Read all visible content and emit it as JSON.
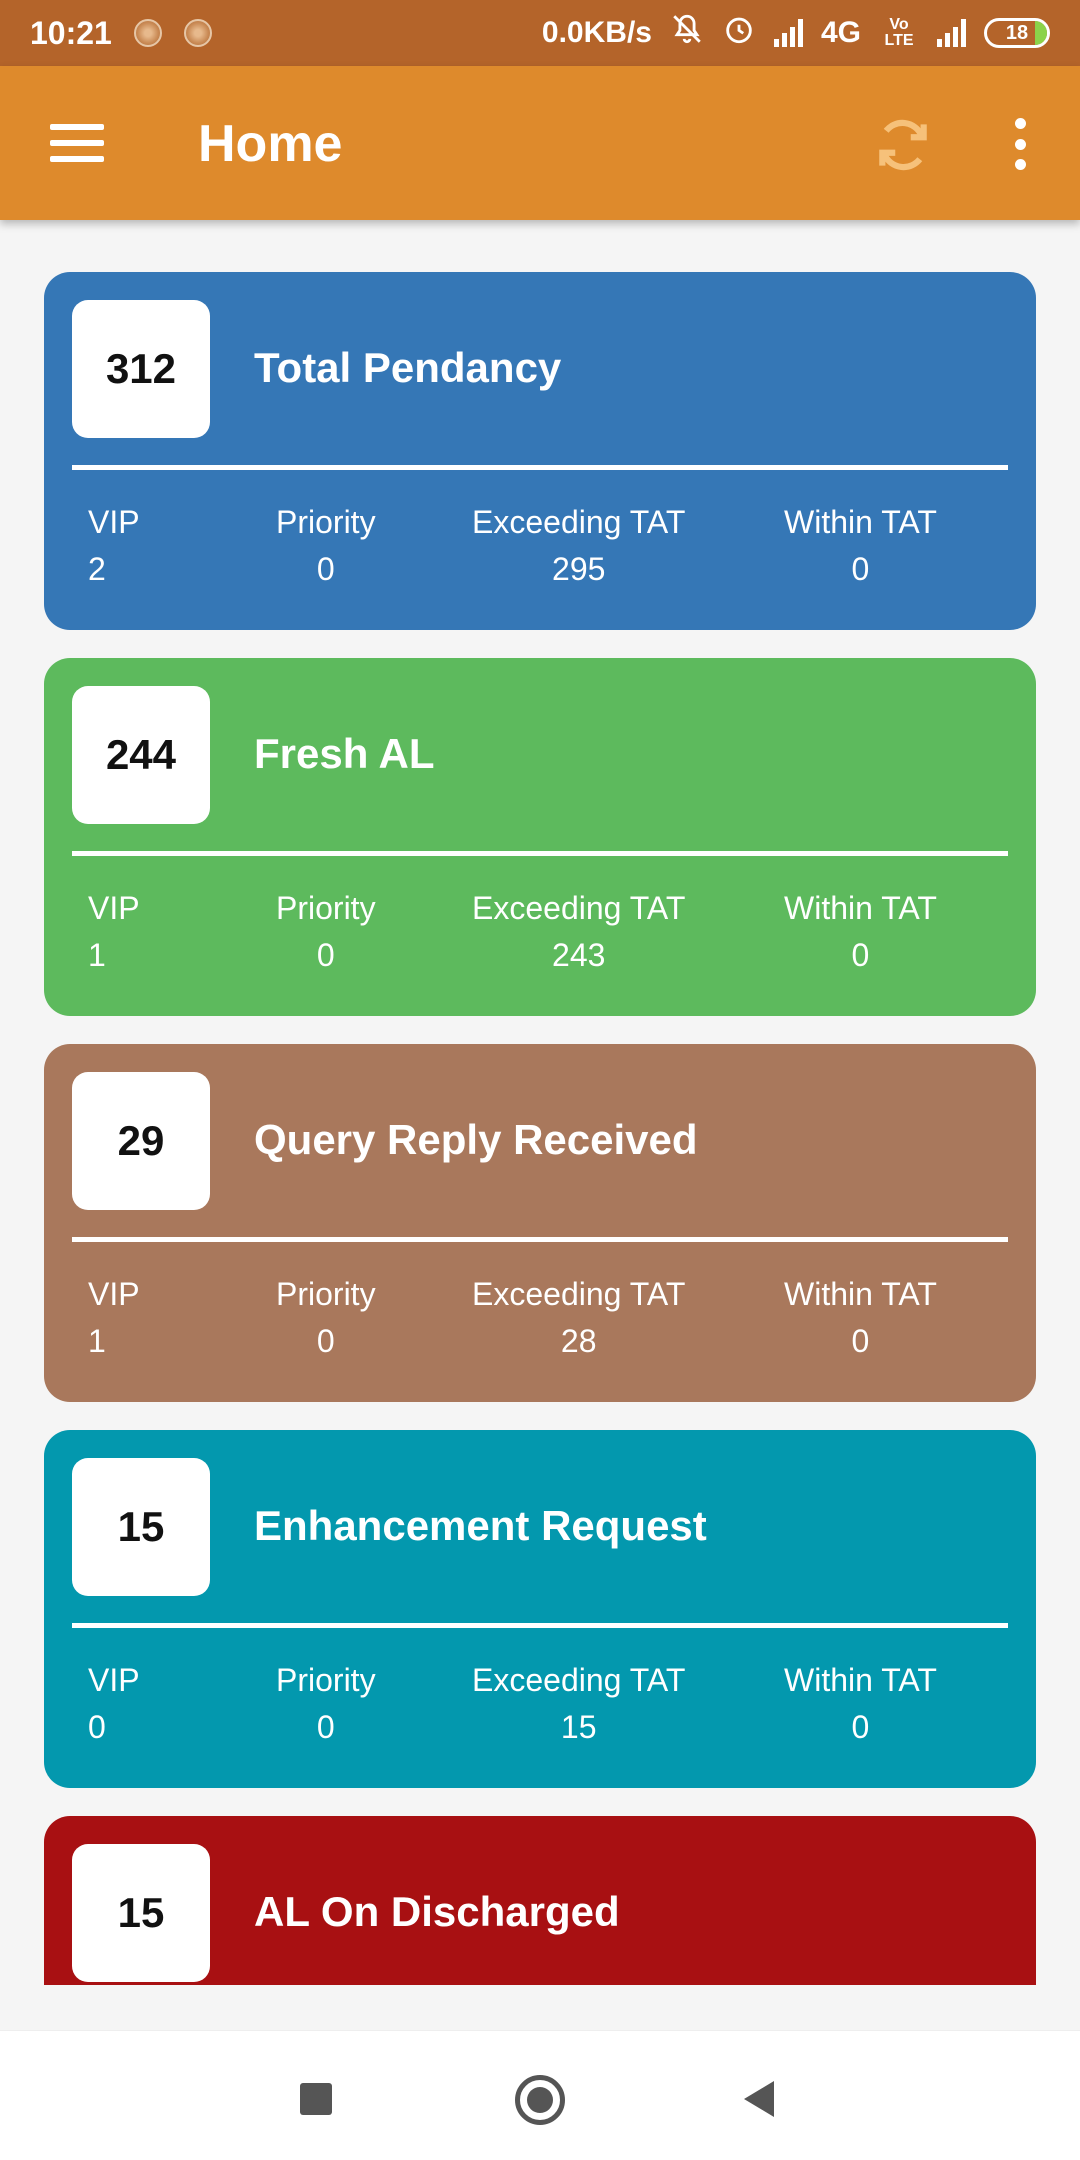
{
  "status_bar": {
    "time": "10:21",
    "network_speed": "0.0KB/s",
    "network_type": "4G",
    "volte": "Vo LTE",
    "battery": "18"
  },
  "app_bar": {
    "title": "Home",
    "icons": [
      "menu-icon",
      "refresh-icon",
      "more-vert-icon"
    ]
  },
  "cards": [
    {
      "count": "312",
      "title": "Total Pendancy",
      "color": "#3577b6",
      "stats": [
        {
          "label": "VIP",
          "value": "2"
        },
        {
          "label": "Priority",
          "value": "0"
        },
        {
          "label": "Exceeding TAT",
          "value": "295"
        },
        {
          "label": "Within TAT",
          "value": "0"
        }
      ]
    },
    {
      "count": "244",
      "title": "Fresh AL",
      "color": "#5dba5d",
      "stats": [
        {
          "label": "VIP",
          "value": "1"
        },
        {
          "label": "Priority",
          "value": "0"
        },
        {
          "label": "Exceeding TAT",
          "value": "243"
        },
        {
          "label": "Within TAT",
          "value": "0"
        }
      ]
    },
    {
      "count": "29",
      "title": "Query Reply Received",
      "color": "#a9785c",
      "stats": [
        {
          "label": "VIP",
          "value": "1"
        },
        {
          "label": "Priority",
          "value": "0"
        },
        {
          "label": "Exceeding TAT",
          "value": "28"
        },
        {
          "label": "Within TAT",
          "value": "0"
        }
      ]
    },
    {
      "count": "15",
      "title": "Enhancement Request",
      "color": "#0398ae",
      "stats": [
        {
          "label": "VIP",
          "value": "0"
        },
        {
          "label": "Priority",
          "value": "0"
        },
        {
          "label": "Exceeding TAT",
          "value": "15"
        },
        {
          "label": "Within TAT",
          "value": "0"
        }
      ]
    },
    {
      "count": "15",
      "title": "AL On Discharged",
      "color": "#a81012",
      "stats": []
    }
  ],
  "nav_bar": {
    "icons": [
      "recents-icon",
      "home-icon",
      "back-icon"
    ]
  }
}
